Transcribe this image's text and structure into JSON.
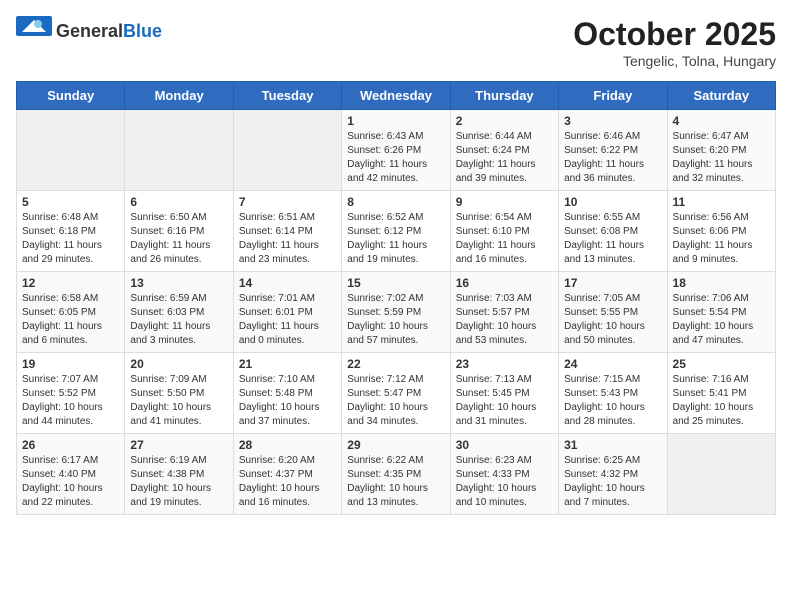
{
  "header": {
    "logo_general": "General",
    "logo_blue": "Blue",
    "title": "October 2025",
    "subtitle": "Tengelic, Tolna, Hungary"
  },
  "weekdays": [
    "Sunday",
    "Monday",
    "Tuesday",
    "Wednesday",
    "Thursday",
    "Friday",
    "Saturday"
  ],
  "weeks": [
    [
      {
        "day": "",
        "info": ""
      },
      {
        "day": "",
        "info": ""
      },
      {
        "day": "",
        "info": ""
      },
      {
        "day": "1",
        "info": "Sunrise: 6:43 AM\nSunset: 6:26 PM\nDaylight: 11 hours\nand 42 minutes."
      },
      {
        "day": "2",
        "info": "Sunrise: 6:44 AM\nSunset: 6:24 PM\nDaylight: 11 hours\nand 39 minutes."
      },
      {
        "day": "3",
        "info": "Sunrise: 6:46 AM\nSunset: 6:22 PM\nDaylight: 11 hours\nand 36 minutes."
      },
      {
        "day": "4",
        "info": "Sunrise: 6:47 AM\nSunset: 6:20 PM\nDaylight: 11 hours\nand 32 minutes."
      }
    ],
    [
      {
        "day": "5",
        "info": "Sunrise: 6:48 AM\nSunset: 6:18 PM\nDaylight: 11 hours\nand 29 minutes."
      },
      {
        "day": "6",
        "info": "Sunrise: 6:50 AM\nSunset: 6:16 PM\nDaylight: 11 hours\nand 26 minutes."
      },
      {
        "day": "7",
        "info": "Sunrise: 6:51 AM\nSunset: 6:14 PM\nDaylight: 11 hours\nand 23 minutes."
      },
      {
        "day": "8",
        "info": "Sunrise: 6:52 AM\nSunset: 6:12 PM\nDaylight: 11 hours\nand 19 minutes."
      },
      {
        "day": "9",
        "info": "Sunrise: 6:54 AM\nSunset: 6:10 PM\nDaylight: 11 hours\nand 16 minutes."
      },
      {
        "day": "10",
        "info": "Sunrise: 6:55 AM\nSunset: 6:08 PM\nDaylight: 11 hours\nand 13 minutes."
      },
      {
        "day": "11",
        "info": "Sunrise: 6:56 AM\nSunset: 6:06 PM\nDaylight: 11 hours\nand 9 minutes."
      }
    ],
    [
      {
        "day": "12",
        "info": "Sunrise: 6:58 AM\nSunset: 6:05 PM\nDaylight: 11 hours\nand 6 minutes."
      },
      {
        "day": "13",
        "info": "Sunrise: 6:59 AM\nSunset: 6:03 PM\nDaylight: 11 hours\nand 3 minutes."
      },
      {
        "day": "14",
        "info": "Sunrise: 7:01 AM\nSunset: 6:01 PM\nDaylight: 11 hours\nand 0 minutes."
      },
      {
        "day": "15",
        "info": "Sunrise: 7:02 AM\nSunset: 5:59 PM\nDaylight: 10 hours\nand 57 minutes."
      },
      {
        "day": "16",
        "info": "Sunrise: 7:03 AM\nSunset: 5:57 PM\nDaylight: 10 hours\nand 53 minutes."
      },
      {
        "day": "17",
        "info": "Sunrise: 7:05 AM\nSunset: 5:55 PM\nDaylight: 10 hours\nand 50 minutes."
      },
      {
        "day": "18",
        "info": "Sunrise: 7:06 AM\nSunset: 5:54 PM\nDaylight: 10 hours\nand 47 minutes."
      }
    ],
    [
      {
        "day": "19",
        "info": "Sunrise: 7:07 AM\nSunset: 5:52 PM\nDaylight: 10 hours\nand 44 minutes."
      },
      {
        "day": "20",
        "info": "Sunrise: 7:09 AM\nSunset: 5:50 PM\nDaylight: 10 hours\nand 41 minutes."
      },
      {
        "day": "21",
        "info": "Sunrise: 7:10 AM\nSunset: 5:48 PM\nDaylight: 10 hours\nand 37 minutes."
      },
      {
        "day": "22",
        "info": "Sunrise: 7:12 AM\nSunset: 5:47 PM\nDaylight: 10 hours\nand 34 minutes."
      },
      {
        "day": "23",
        "info": "Sunrise: 7:13 AM\nSunset: 5:45 PM\nDaylight: 10 hours\nand 31 minutes."
      },
      {
        "day": "24",
        "info": "Sunrise: 7:15 AM\nSunset: 5:43 PM\nDaylight: 10 hours\nand 28 minutes."
      },
      {
        "day": "25",
        "info": "Sunrise: 7:16 AM\nSunset: 5:41 PM\nDaylight: 10 hours\nand 25 minutes."
      }
    ],
    [
      {
        "day": "26",
        "info": "Sunrise: 6:17 AM\nSunset: 4:40 PM\nDaylight: 10 hours\nand 22 minutes."
      },
      {
        "day": "27",
        "info": "Sunrise: 6:19 AM\nSunset: 4:38 PM\nDaylight: 10 hours\nand 19 minutes."
      },
      {
        "day": "28",
        "info": "Sunrise: 6:20 AM\nSunset: 4:37 PM\nDaylight: 10 hours\nand 16 minutes."
      },
      {
        "day": "29",
        "info": "Sunrise: 6:22 AM\nSunset: 4:35 PM\nDaylight: 10 hours\nand 13 minutes."
      },
      {
        "day": "30",
        "info": "Sunrise: 6:23 AM\nSunset: 4:33 PM\nDaylight: 10 hours\nand 10 minutes."
      },
      {
        "day": "31",
        "info": "Sunrise: 6:25 AM\nSunset: 4:32 PM\nDaylight: 10 hours\nand 7 minutes."
      },
      {
        "day": "",
        "info": ""
      }
    ]
  ]
}
